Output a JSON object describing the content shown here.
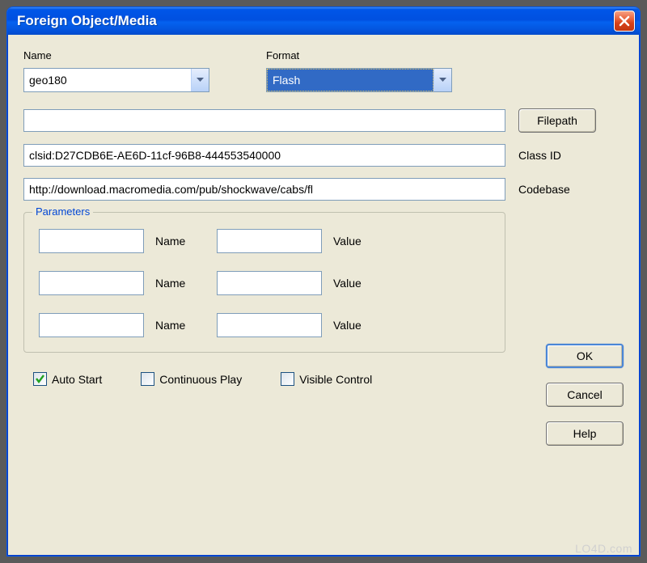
{
  "window": {
    "title": "Foreign Object/Media"
  },
  "labels": {
    "name": "Name",
    "format": "Format",
    "filepath": "Filepath",
    "classid": "Class ID",
    "codebase": "Codebase",
    "parameters": "Parameters",
    "param_name": "Name",
    "param_value": "Value"
  },
  "fields": {
    "name_value": "geo180",
    "format_value": "Flash",
    "filepath_value": "",
    "classid_value": "clsid:D27CDB6E-AE6D-11cf-96B8-444553540000",
    "codebase_value": "http://download.macromedia.com/pub/shockwave/cabs/fl"
  },
  "buttons": {
    "ok": "OK",
    "cancel": "Cancel",
    "help": "Help"
  },
  "checks": {
    "autostart": "Auto Start",
    "continuous": "Continuous Play",
    "visible": "Visible Control"
  },
  "watermark": "LO4D.com"
}
